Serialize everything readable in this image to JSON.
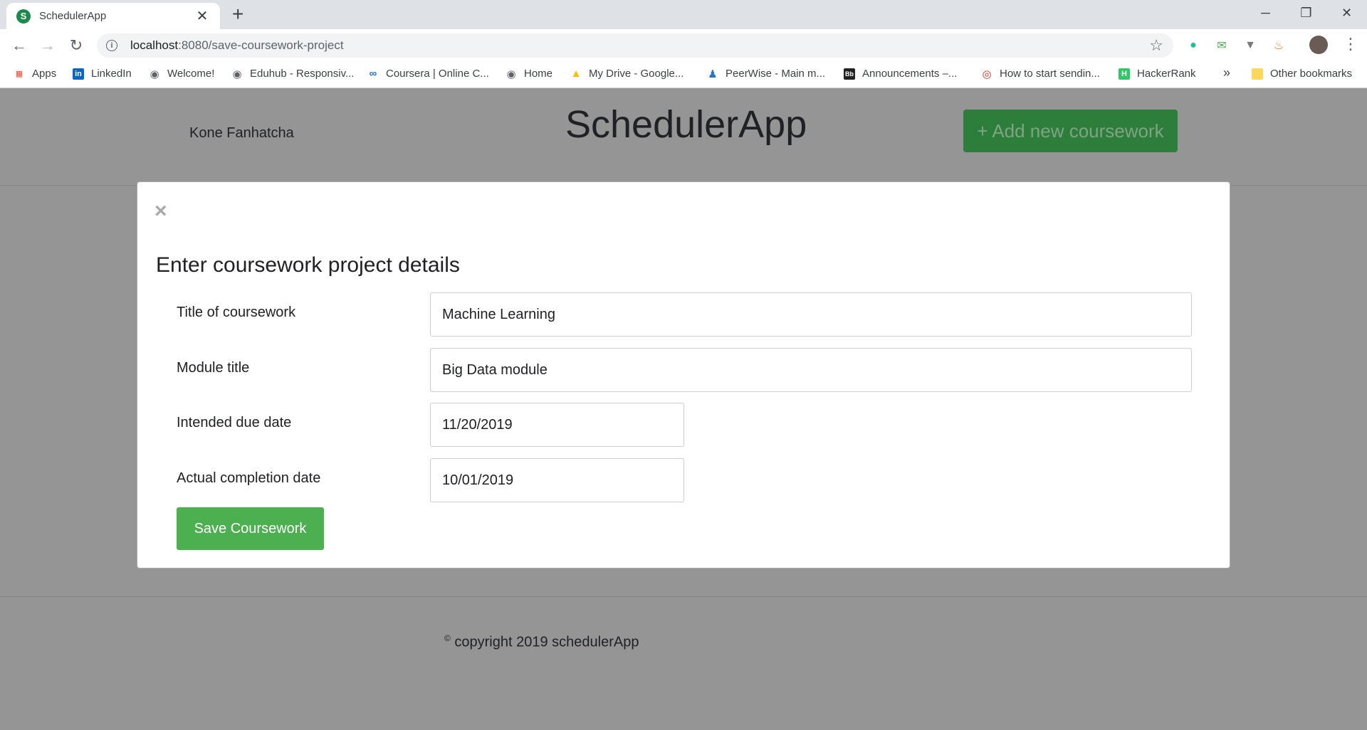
{
  "browser": {
    "tab_title": "SchedulerApp",
    "tab_favicon_letter": "S",
    "url_host": "localhost",
    "url_path": ":8080/save-coursework-project",
    "bookmarks": [
      {
        "label": "Apps",
        "icon": "apps-grid-icon"
      },
      {
        "label": "LinkedIn",
        "icon": "linkedin-icon"
      },
      {
        "label": "Welcome!",
        "icon": "globe-icon"
      },
      {
        "label": "Eduhub - Responsiv...",
        "icon": "globe-icon"
      },
      {
        "label": "Coursera | Online C...",
        "icon": "coursera-icon"
      },
      {
        "label": "Home",
        "icon": "globe-icon"
      },
      {
        "label": "My Drive - Google...",
        "icon": "google-drive-icon"
      },
      {
        "label": "PeerWise - Main m...",
        "icon": "peerwise-icon"
      },
      {
        "label": "Announcements –...",
        "icon": "blackboard-icon"
      },
      {
        "label": "How to start sendin...",
        "icon": "target-icon"
      },
      {
        "label": "HackerRank",
        "icon": "hackerrank-icon"
      }
    ],
    "more_bookmarks": "»",
    "other_bookmarks": "Other bookmarks"
  },
  "header": {
    "user_name": "Kone Fanhatcha",
    "app_title": "SchedulerApp",
    "add_button_label": "+ Add new coursework"
  },
  "modal": {
    "close_symbol": "×",
    "heading": "Enter coursework project details",
    "fields": [
      {
        "label": "Title of coursework",
        "value": "Machine Learning"
      },
      {
        "label": "Module title",
        "value": "Big Data module"
      },
      {
        "label": "Intended due date",
        "value": "11/20/2019"
      },
      {
        "label": "Actual completion date",
        "value": "10/01/2019"
      }
    ],
    "save_button_label": "Save Coursework"
  },
  "footer": {
    "copyright_symbol": "©",
    "copyright_text": " copyright 2019 schedulerApp"
  }
}
